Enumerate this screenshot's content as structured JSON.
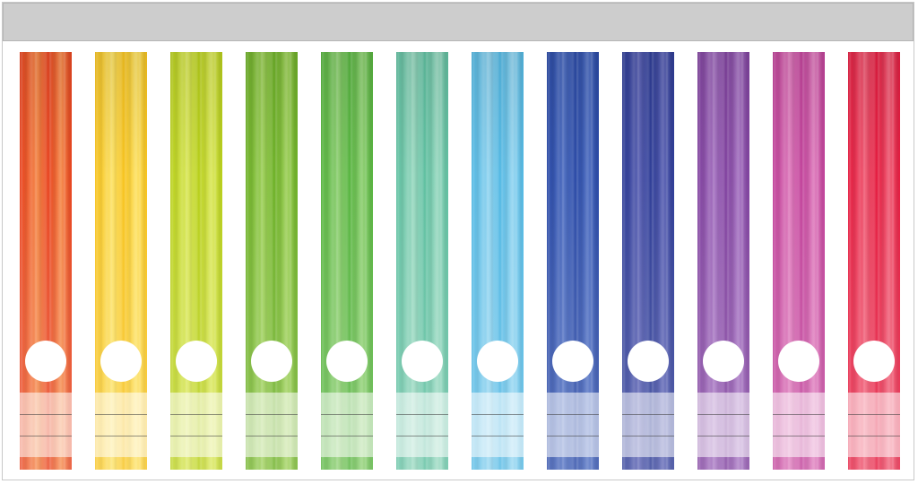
{
  "spines": [
    {
      "name": "red-orange",
      "color": "#e8401c",
      "light": "#f58a4a"
    },
    {
      "name": "yellow",
      "color": "#f7c21a",
      "light": "#fde368"
    },
    {
      "name": "lime",
      "color": "#b7cf16",
      "light": "#dbe85c"
    },
    {
      "name": "green",
      "color": "#6aaf22",
      "light": "#9fd15b"
    },
    {
      "name": "leaf-green",
      "color": "#54b33c",
      "light": "#8fd073"
    },
    {
      "name": "teal",
      "color": "#5cbf9f",
      "light": "#9ad9c1"
    },
    {
      "name": "sky-blue",
      "color": "#4fb7e3",
      "light": "#95d6f1"
    },
    {
      "name": "royal-blue",
      "color": "#2747a5",
      "light": "#4f6fc2"
    },
    {
      "name": "indigo",
      "color": "#2b3a95",
      "light": "#5b62b4"
    },
    {
      "name": "purple",
      "color": "#7e3e9d",
      "light": "#a674c2"
    },
    {
      "name": "magenta",
      "color": "#c03e98",
      "light": "#df7cbd"
    },
    {
      "name": "crimson",
      "color": "#e4183c",
      "light": "#f05c75"
    }
  ]
}
